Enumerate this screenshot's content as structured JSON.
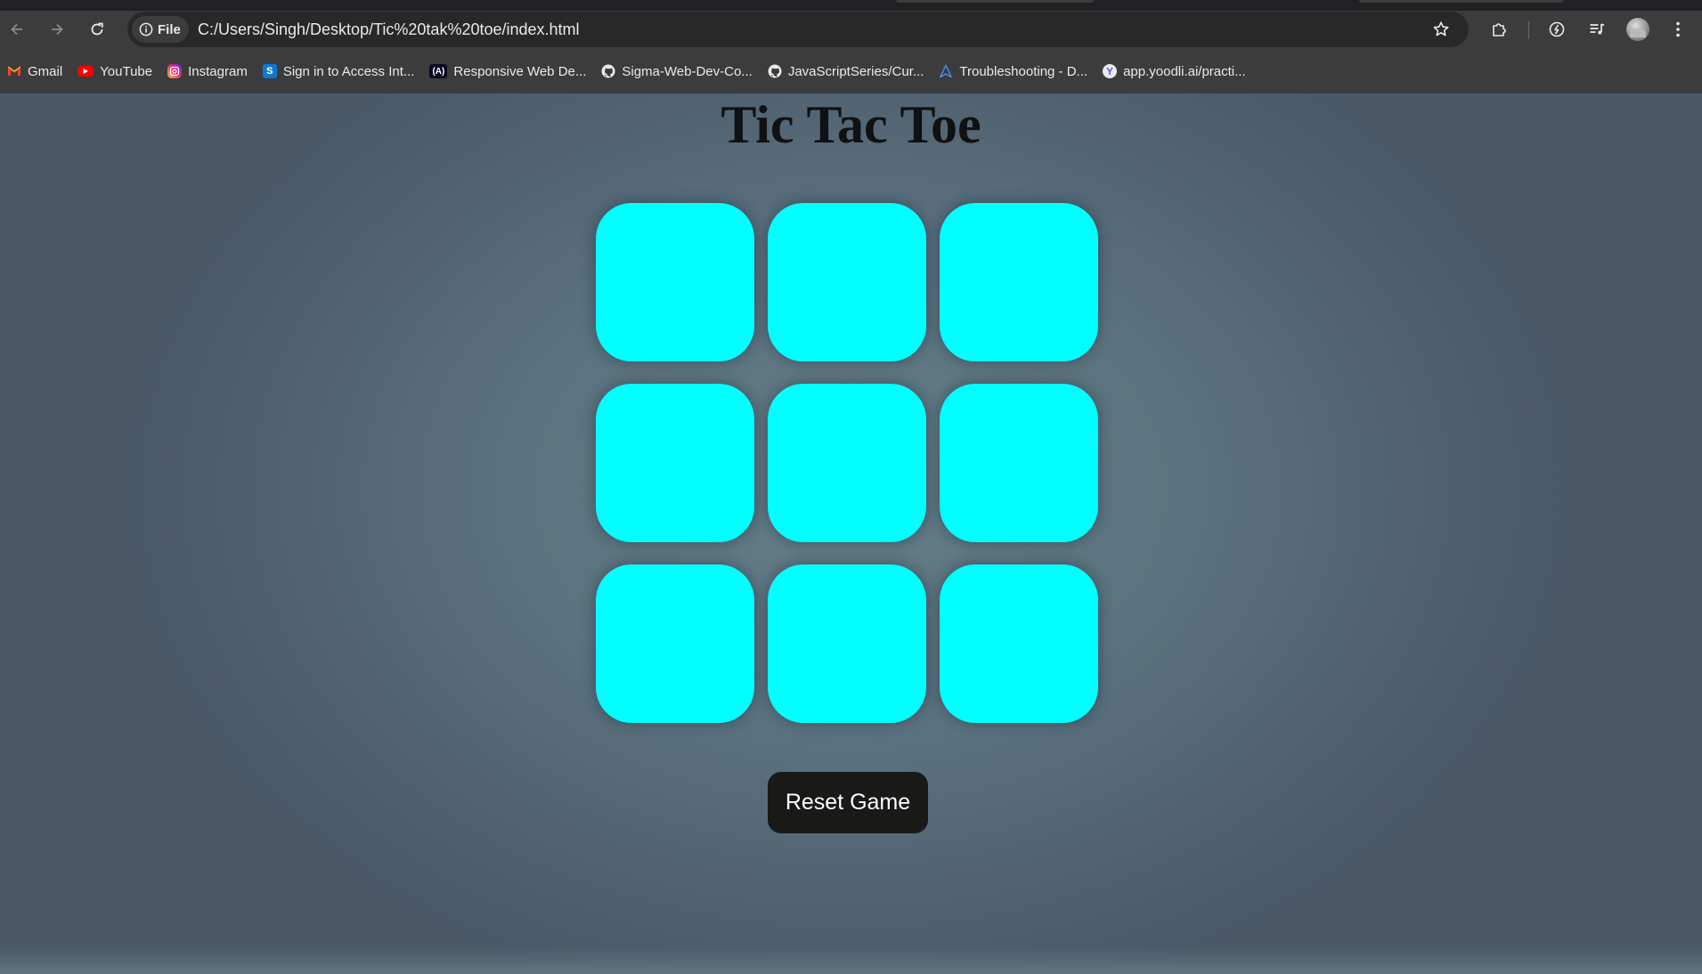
{
  "browser": {
    "address_chip_label": "File",
    "url": "C:/Users/Singh/Desktop/Tic%20tak%20toe/index.html",
    "bookmarks": [
      {
        "label": "Gmail",
        "icon": "gmail-icon"
      },
      {
        "label": "YouTube",
        "icon": "youtube-icon"
      },
      {
        "label": "Instagram",
        "icon": "instagram-icon"
      },
      {
        "label": "Sign in to Access Int...",
        "icon": "sharepoint-icon"
      },
      {
        "label": "Responsive Web De...",
        "icon": "freecodecamp-icon"
      },
      {
        "label": "Sigma-Web-Dev-Co...",
        "icon": "github-icon"
      },
      {
        "label": "JavaScriptSeries/Cur...",
        "icon": "github-icon"
      },
      {
        "label": "Troubleshooting - D...",
        "icon": "arrow-a-icon"
      },
      {
        "label": "app.yoodli.ai/practi...",
        "icon": "yoodli-icon"
      }
    ]
  },
  "game": {
    "title": "Tic Tac Toe",
    "cells": [
      "",
      "",
      "",
      "",
      "",
      "",
      "",
      "",
      ""
    ],
    "reset_label": "Reset Game",
    "cell_color": "#00ffff",
    "button_color": "#191918"
  }
}
